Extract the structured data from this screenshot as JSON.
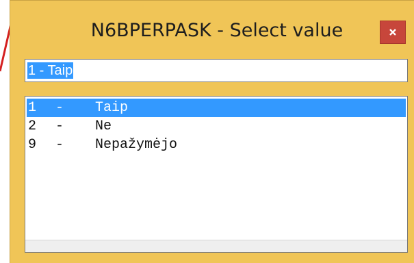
{
  "window": {
    "title": "N6BPERPASK - Select value",
    "close_glyph": "×",
    "accent_color": "#f0c557",
    "close_color": "#c7463b"
  },
  "input": {
    "value": "1 - Taip",
    "selection_color": "#3399ff"
  },
  "list": {
    "items": [
      {
        "code": "1",
        "separator": "-",
        "label": "Taip",
        "selected": true
      },
      {
        "code": "2",
        "separator": "-",
        "label": "Ne",
        "selected": false
      },
      {
        "code": "9",
        "separator": "-",
        "label": "Nepažymėjo",
        "selected": false
      }
    ]
  },
  "icons": {
    "close": "close-icon"
  }
}
